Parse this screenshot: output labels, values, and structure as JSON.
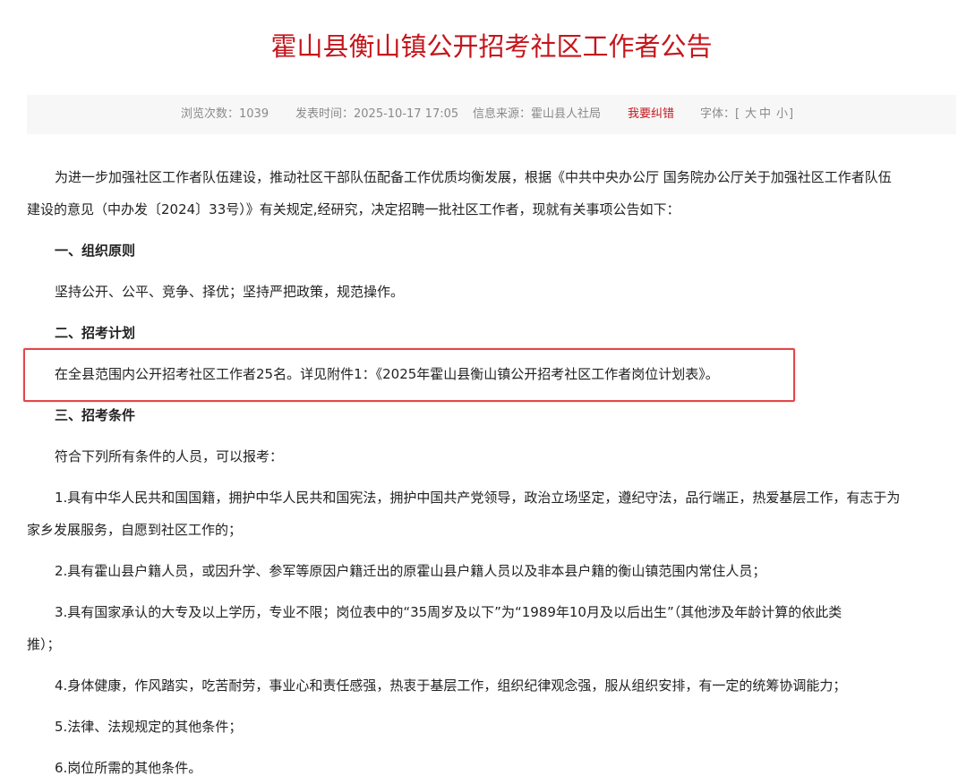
{
  "article": {
    "title": "霍山县衡山镇公开招考社区工作者公告"
  },
  "meta": {
    "views": "浏览次数：1039",
    "published": "发表时间：2025-10-17 17:05",
    "source": "信息来源：霍山县人社局",
    "report_error": "我要纠错",
    "font_label": "字体：[",
    "font_large": "大",
    "font_medium": "中",
    "font_small": "小",
    "font_close": "]"
  },
  "body": {
    "intro_line1": "为进一步加强社区工作者队伍建设，推动社区干部队伍配备工作优质均衡发展，根据《中共中央办公厅 国务院办公厅关于加强社区工作者队伍",
    "intro_line2": "建设的意见（中办发〔2024〕33号）》有关规定,经研究，决定招聘一批社区工作者，现就有关事项公告如下：",
    "section1_heading": "一、组织原则",
    "section1_text": "坚持公开、公平、竞争、择优；坚持严把政策，规范操作。",
    "section2_heading": "二、招考计划",
    "section2_text": "在全县范围内公开招考社区工作者25名。详见附件1：《2025年霍山县衡山镇公开招考社区工作者岗位计划表》。",
    "section3_heading": "三、招考条件",
    "section3_intro": "符合下列所有条件的人员，可以报考：",
    "item1_line1": "1.具有中华人民共和国国籍，拥护中华人民共和国宪法，拥护中国共产党领导，政治立场坚定，遵纪守法，品行端正，热爱基层工作，有志于为",
    "item1_line2": "家乡发展服务，自愿到社区工作的；",
    "item2": "2.具有霍山县户籍人员，或因升学、参军等原因户籍迁出的原霍山县户籍人员以及非本县户籍的衡山镇范围内常住人员；",
    "item3_line1": "3.具有国家承认的大专及以上学历，专业不限；岗位表中的“35周岁及以下”为“1989年10月及以后出生”（其他涉及年龄计算的依此类",
    "item3_line2": "推）；",
    "item4": "4.身体健康，作风踏实，吃苦耐劳，事业心和责任感强，热衷于基层工作，组织纪律观念强，服从组织安排，有一定的统筹协调能力；",
    "item5": "5.法律、法规规定的其他条件；",
    "item6": "6.岗位所需的其他条件。"
  },
  "colors": {
    "title_red": "#c4161c",
    "highlight_border": "#e0484b",
    "meta_gray": "#8a8a8a",
    "meta_bg": "#f7f7f7"
  }
}
